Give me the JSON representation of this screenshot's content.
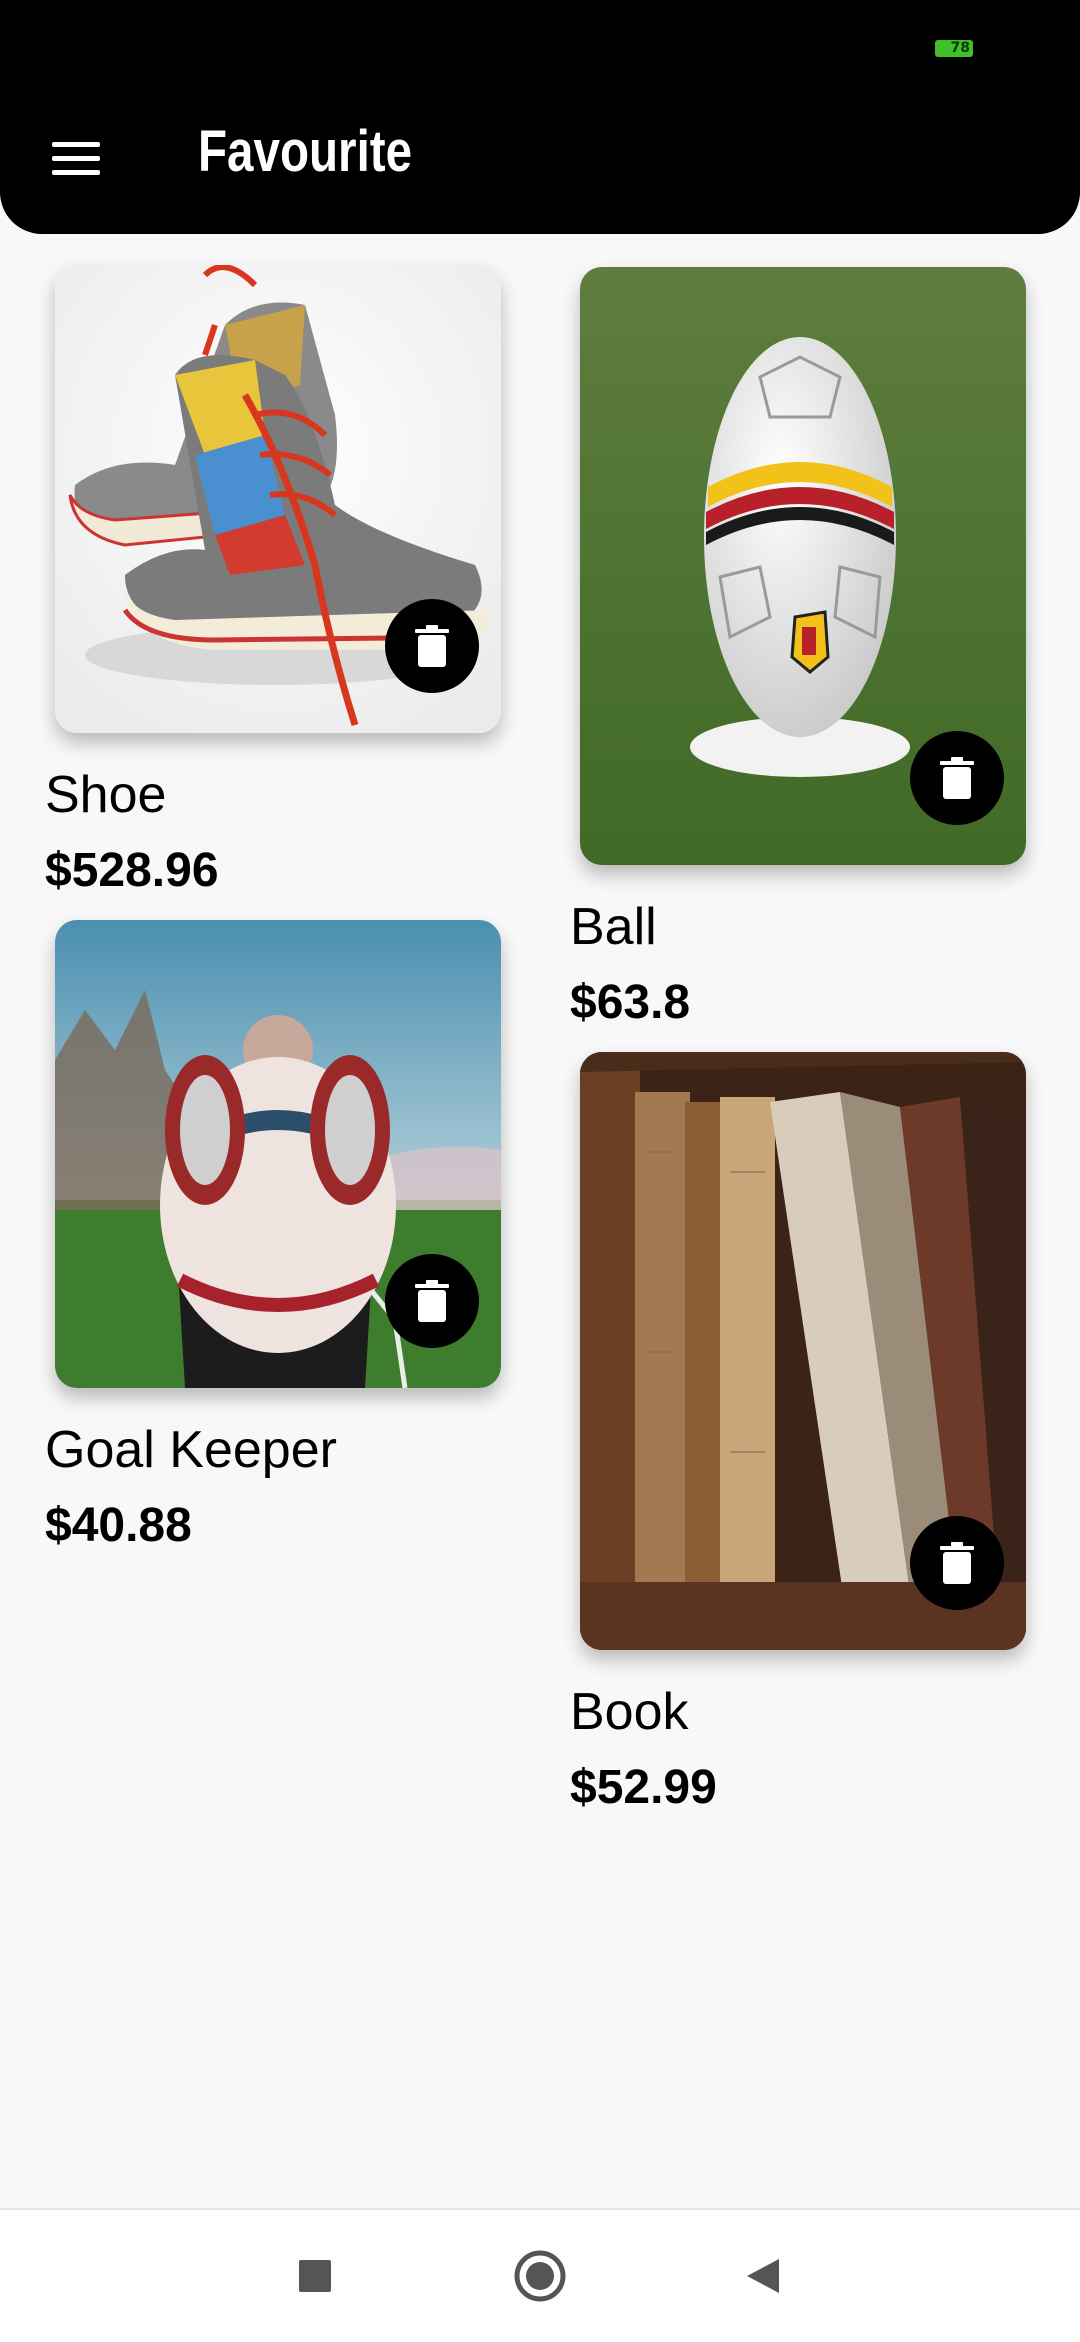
{
  "status_bar": {
    "battery_level": "78"
  },
  "app_bar": {
    "title": "Favourite",
    "menu_icon": "hamburger-menu-icon"
  },
  "items": [
    {
      "name": "Shoe",
      "price": "$528.96",
      "image": "sneakers-photo"
    },
    {
      "name": "Ball",
      "price": "$63.8",
      "image": "soccer-ball-photo"
    },
    {
      "name": "Goal Keeper",
      "price": "$40.88",
      "image": "goalkeeper-photo"
    },
    {
      "name": "Book",
      "price": "$52.99",
      "image": "old-books-photo"
    }
  ],
  "delete_icon": "trash-icon",
  "nav_bar": {
    "recents": "square-icon",
    "home": "circle-icon",
    "back": "triangle-back-icon"
  }
}
